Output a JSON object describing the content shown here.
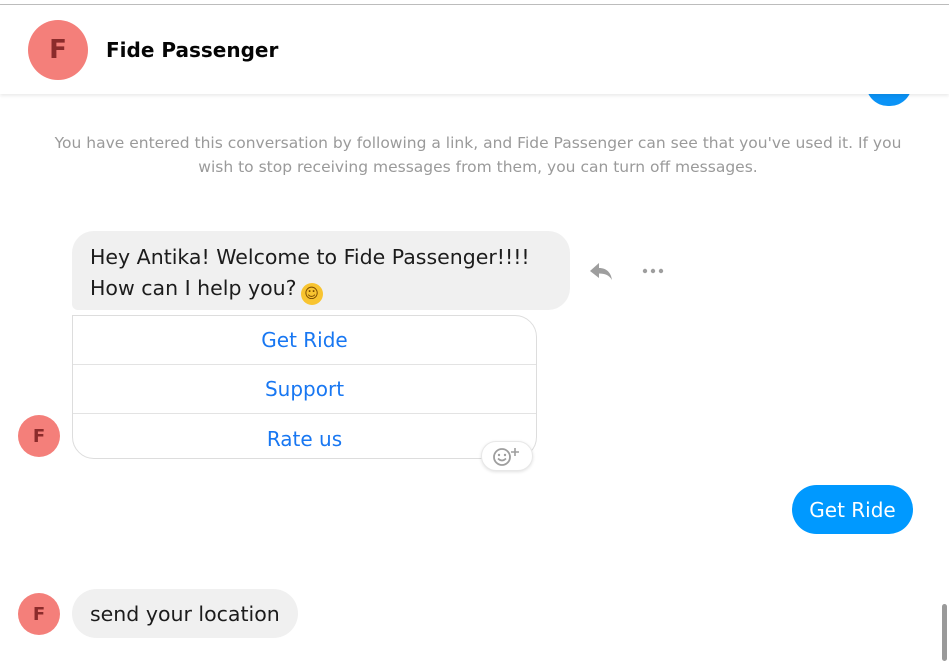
{
  "header": {
    "avatar_letter": "F",
    "title": "Fide Passenger"
  },
  "notice": "You have entered this conversation by following a link, and Fide Passenger can see that you've used it. If you wish to stop receiving messages from them, you can turn off messages.",
  "messages": {
    "welcome_line1": "Hey Antika! Welcome to Fide Passenger!!!!",
    "welcome_line2": "How can I help you?",
    "welcome_emoji": "☺",
    "quick_replies": [
      "Get Ride",
      "Support",
      "Rate us"
    ],
    "sent": "Get Ride",
    "location_request": "send your location",
    "sender_avatar_letter": "F"
  },
  "icons": {
    "reply": "reply-icon",
    "more": "more-options-icon",
    "react": "add-reaction-icon"
  },
  "colors": {
    "accent": "#0099ff",
    "link": "#1877f2",
    "avatar_bg": "#f47f7a",
    "bubble_bg": "#f0f0f0"
  }
}
